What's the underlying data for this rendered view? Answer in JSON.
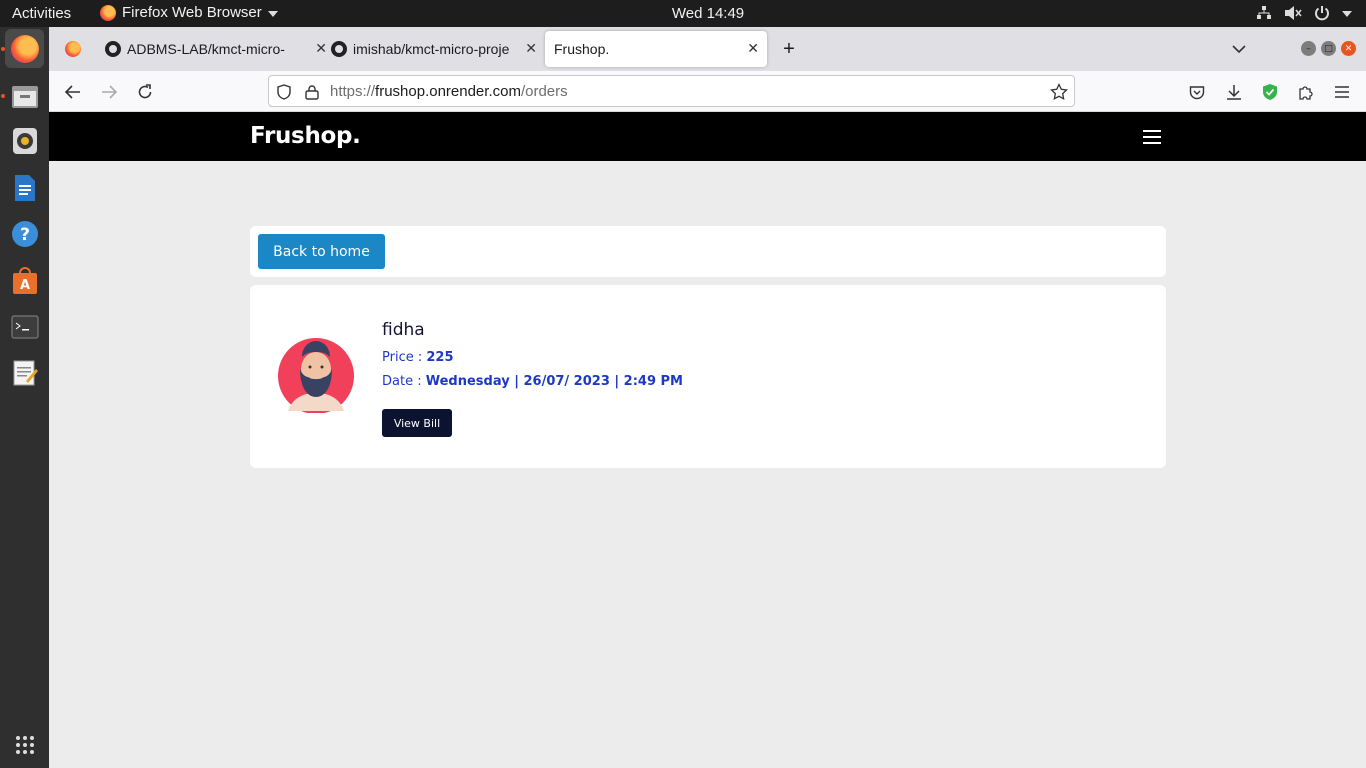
{
  "topbar": {
    "activities": "Activities",
    "app_name": "Firefox Web Browser",
    "clock": "Wed 14:49"
  },
  "tabs": [
    {
      "title": "ADBMS-LAB/kmct-micro-",
      "icon": "github-icon"
    },
    {
      "title": "imishab/kmct-micro-proje",
      "icon": "github-icon"
    },
    {
      "title": "Frushop.",
      "icon": "none",
      "selected": true
    }
  ],
  "urlbar": {
    "scheme": "https://",
    "host": "frushop.onrender.com",
    "path": "/orders"
  },
  "site": {
    "brand": "Frushop."
  },
  "back_button": "Back to home",
  "order": {
    "customer": "fidha",
    "price_label": "Price : ",
    "price": "225",
    "date_label": "Date : ",
    "date": "Wednesday | 26/07/ 2023 | 2:49 PM",
    "view_bill": "View Bill"
  },
  "colors": {
    "accent_blue": "#1b87c4",
    "dark_navy": "#0c1331",
    "text_blue": "#1d39c4",
    "page_bg": "#ececec",
    "brand_bar": "#000000"
  }
}
